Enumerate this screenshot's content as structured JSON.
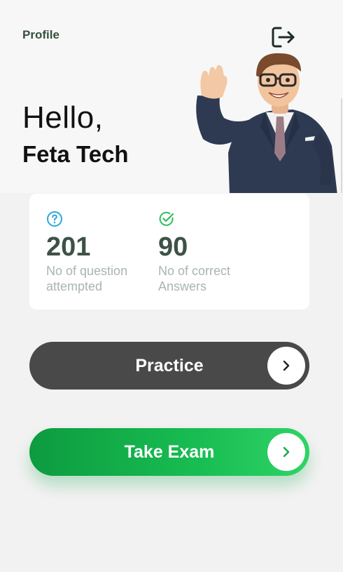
{
  "header": {
    "profile_label": "Profile",
    "greeting": "Hello,",
    "user_name": "Feta Tech"
  },
  "stats": [
    {
      "icon": "question-circle-icon",
      "value": "201",
      "label": "No of question attempted",
      "color": "#2ba8d6"
    },
    {
      "icon": "check-circle-icon",
      "value": "90",
      "label": "No of correct Answers",
      "color": "#2fbf5c"
    }
  ],
  "actions": {
    "practice_label": "Practice",
    "exam_label": "Take Exam"
  },
  "colors": {
    "stat_value": "#3d5247",
    "practice_bg": "#4a4949",
    "exam_bg": "#18bd52",
    "profile_text": "#34503e"
  }
}
